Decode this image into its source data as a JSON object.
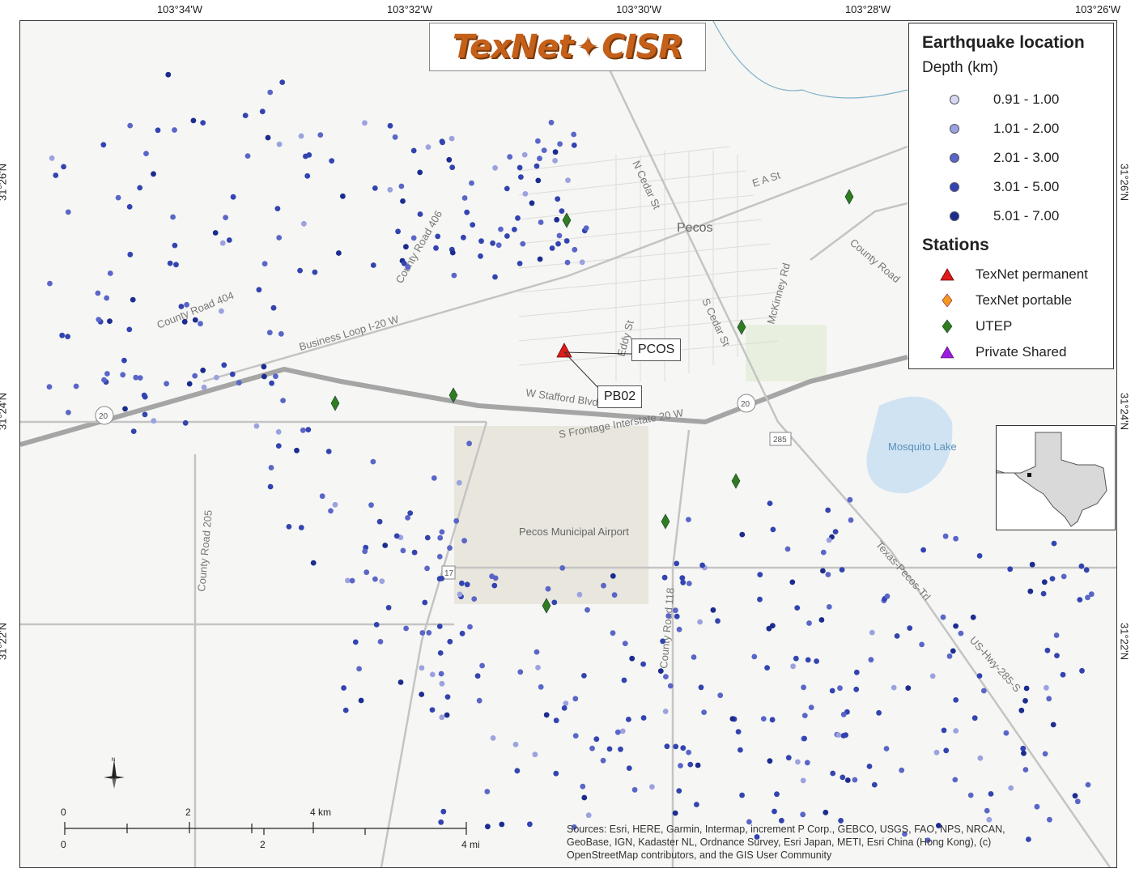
{
  "logo": {
    "text_left": "TexNet",
    "text_right": "CISR"
  },
  "graticule": {
    "longitudes": [
      "103°34'W",
      "103°32'W",
      "103°30'W",
      "103°28'W",
      "103°26'W"
    ],
    "latitudes": [
      "31°26'N",
      "31°24'N",
      "31°22'N"
    ]
  },
  "place_labels": {
    "town": "Pecos",
    "lake": "Mosquito Lake",
    "airport": "Pecos Municipal Airport",
    "roads": [
      "County Road 404",
      "County Road 406",
      "Business Loop I-20 W",
      "N Cedar St",
      "S Cedar St",
      "E A St",
      "McKinney Rd",
      "County Road",
      "Eddy St",
      "W Stafford Blvd",
      "S Frontage Interstate 20 W",
      "County Road 205",
      "County Road 118",
      "Texas-Pecos-Trl",
      "US-Hwy-285-S"
    ],
    "shields": [
      "20",
      "20",
      "285",
      "17"
    ]
  },
  "station_callouts": {
    "pcos": "PCOS",
    "pb02": "PB02"
  },
  "legend": {
    "title": "Earthquake location",
    "depth_title": "Depth (km)",
    "depth_classes": [
      {
        "label": "0.91 - 1.00",
        "color": "#d6d8f0"
      },
      {
        "label": "1.01 - 2.00",
        "color": "#9ba2df"
      },
      {
        "label": "2.01 - 3.00",
        "color": "#5a66c7"
      },
      {
        "label": "3.01 - 5.00",
        "color": "#3344b0"
      },
      {
        "label": "5.01 - 7.00",
        "color": "#1c2c8f"
      }
    ],
    "stations_title": "Stations",
    "station_types": [
      {
        "label": "TexNet permanent",
        "color": "#e01b1b",
        "shape": "triangle"
      },
      {
        "label": "TexNet portable",
        "color": "#f39a1c",
        "shape": "diamond"
      },
      {
        "label": "UTEP",
        "color": "#2f7d1f",
        "shape": "diamond"
      },
      {
        "label": "Private Shared",
        "color": "#9a1ce0",
        "shape": "triangle"
      }
    ]
  },
  "scale_bar": {
    "km_labels": [
      "0",
      "2",
      "4 km"
    ],
    "mi_labels": [
      "0",
      "2",
      "4 mi"
    ]
  },
  "attribution": "Sources: Esri, HERE, Garmin, Intermap, increment P Corp., GEBCO, USGS, FAO, NPS, NRCAN, GeoBase, IGN, Kadaster NL, Ordnance Survey, Esri Japan, METI, Esri China (Hong Kong), (c) OpenStreetMap contributors, and the GIS User Community",
  "north_arrow": "N"
}
